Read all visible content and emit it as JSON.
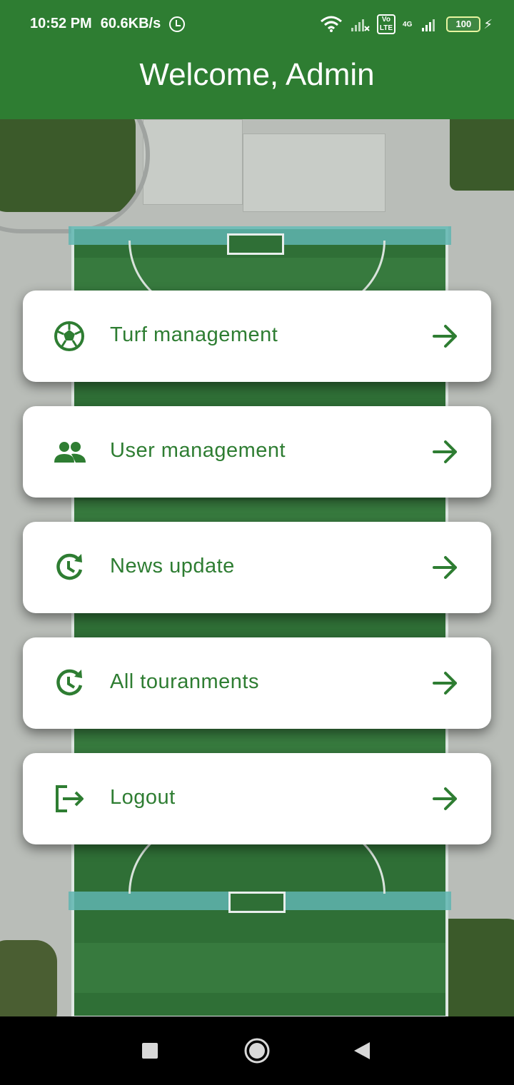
{
  "status_bar": {
    "time": "10:52 PM",
    "speed": "60.6KB/s",
    "battery": "100",
    "volte": "Vo\nLTE",
    "network": "4G"
  },
  "app_bar": {
    "title": "Welcome, Admin"
  },
  "menu": {
    "items": [
      {
        "label": "Turf management",
        "icon": "soccer-ball-icon"
      },
      {
        "label": "User management",
        "icon": "people-icon"
      },
      {
        "label": "News update",
        "icon": "update-clock-icon"
      },
      {
        "label": "All touranments",
        "icon": "update-clock-icon"
      },
      {
        "label": "Logout",
        "icon": "logout-icon"
      }
    ]
  },
  "colors": {
    "primary": "#2e7d32",
    "card": "#ffffff"
  },
  "nav_bar": {
    "buttons": [
      "recents-icon",
      "home-icon",
      "back-icon"
    ]
  }
}
